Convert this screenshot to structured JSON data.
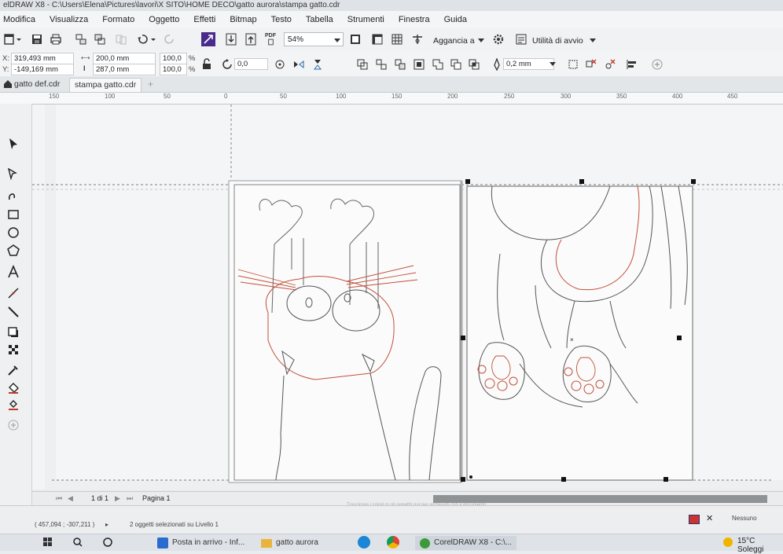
{
  "title_bar": {
    "text": "elDRAW X8 - C:\\Users\\Elena\\Pictures\\lavori\\X SITO\\HOME DECO\\gatto aurora\\stampa gatto.cdr"
  },
  "menu": [
    "Modifica",
    "Visualizza",
    "Formato",
    "Oggetto",
    "Effetti",
    "Bitmap",
    "Testo",
    "Tabella",
    "Strumenti",
    "Finestra",
    "Guida"
  ],
  "toolbar": {
    "pdf_label": "PDF",
    "zoom": "54%",
    "snap_label": "Aggancia a",
    "launch_label": "Utilità di avvio"
  },
  "property_bar": {
    "x_label": "X:",
    "x_value": "319,493 mm",
    "y_label": "Y:",
    "y_value": "-149,169 mm",
    "width": "200,0 mm",
    "height": "287,0 mm",
    "scale_x": "100,0",
    "scale_y": "100,0",
    "percent": "%",
    "rotation": "0,0",
    "outline_width": "0,2 mm"
  },
  "tabs": [
    {
      "label": "gatto def.cdr",
      "active": false
    },
    {
      "label": "stampa gatto.cdr",
      "active": true
    }
  ],
  "ruler": [
    "150",
    "100",
    "50",
    "0",
    "50",
    "100",
    "150",
    "200",
    "250",
    "300",
    "350",
    "400",
    "450"
  ],
  "page_nav": {
    "counter": "1 di 1",
    "page_tab": "Pagina 1",
    "hint": "Trascinare i colori (o gli oggetti) qui per archiviarli con il documento"
  },
  "status": {
    "coords": "( 457,094 ; -307,211 )",
    "selection": "2 oggetti selezionati su Livello 1",
    "fill_label": "Nessuno"
  },
  "taskbar": {
    "items": [
      "Posta in arrivo - Inf...",
      "gatto aurora",
      "CorelDRAW X8 - C:\\..."
    ],
    "weather": "15°C Soleggi"
  },
  "colors": {
    "accent": "#4a2b8c",
    "outline_red": "#c0503a",
    "outline_dark": "#555555",
    "page": "#ffffff"
  }
}
